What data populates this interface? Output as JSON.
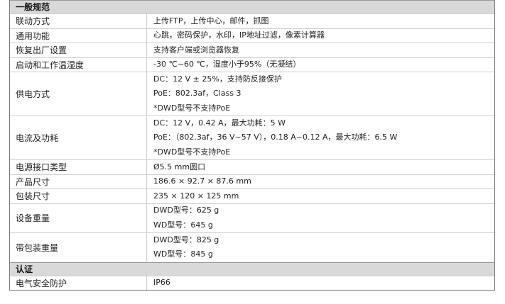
{
  "sections": [
    {
      "title": "一般规范",
      "rows": [
        {
          "label": "联动方式",
          "values": [
            "上传FTP，上传中心，邮件，抓图"
          ]
        },
        {
          "label": "通用功能",
          "values": [
            "心跳，密码保护，水印，IP地址过滤，像素计算器"
          ]
        },
        {
          "label": "恢复出厂设置",
          "values": [
            "支持客户端或浏览器恢复"
          ]
        },
        {
          "label": "启动和工作温湿度",
          "values": [
            "-30 ℃~60 ℃，湿度小于95%（无凝结）"
          ]
        },
        {
          "label": "供电方式",
          "values": [
            "DC：12 V ± 25%，支持防反接保护",
            "PoE：802.3af，Class 3",
            "*DWD型号不支持PoE"
          ]
        },
        {
          "label": "电流及功耗",
          "values": [
            "DC：12 V，0.42 A，最大功耗：5 W",
            "PoE：（802.3af，36 V~57 V），0.18 A~0.12 A，最大功耗：6.5 W",
            "*DWD型号不支持PoE"
          ]
        },
        {
          "label": "电源接口类型",
          "values": [
            "Ø5.5 mm圆口"
          ]
        },
        {
          "label": "产品尺寸",
          "values": [
            "186.6 × 92.7 × 87.6 mm"
          ]
        },
        {
          "label": "包装尺寸",
          "values": [
            "235 × 120 × 125 mm"
          ]
        },
        {
          "label": "设备重量",
          "values": [
            "DWD型号：625 g",
            "WD型号：645 g"
          ]
        },
        {
          "label": "带包装重量",
          "values": [
            "DWD型号：825 g",
            "WD型号：845 g"
          ]
        }
      ]
    },
    {
      "title": "认证",
      "rows": [
        {
          "label": "电气安全防护",
          "values": [
            "IP66"
          ]
        }
      ]
    }
  ]
}
